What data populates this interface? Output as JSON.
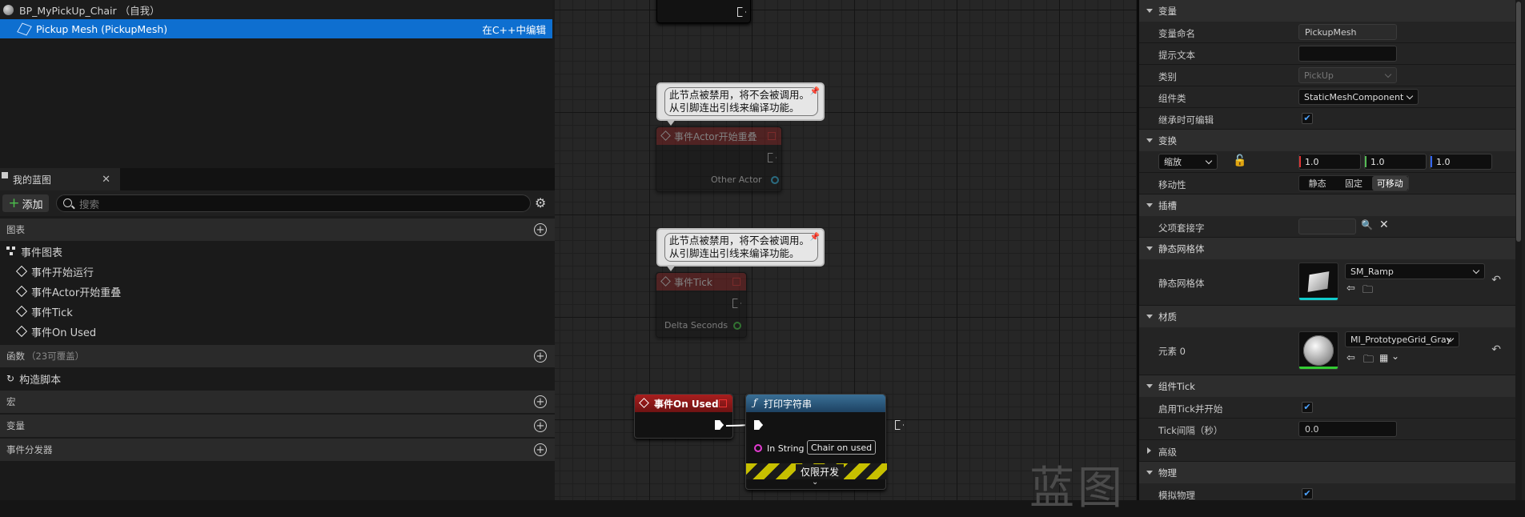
{
  "components": {
    "root_label": "BP_MyPickUp_Chair （自我）",
    "selected_label": "Pickup Mesh (PickupMesh)",
    "selected_action": "在C++中编辑"
  },
  "my_blueprint": {
    "tab_label": "我的蓝图",
    "add_label": "添加",
    "search_placeholder": "搜索",
    "sections": {
      "graphs": "图表",
      "functions": "函数",
      "functions_sub": "（23可覆盖）",
      "macros": "宏",
      "variables": "变量",
      "dispatchers": "事件分发器"
    },
    "graph_items": [
      "事件图表",
      "事件开始运行",
      "事件Actor开始重叠",
      "事件Tick",
      "事件On Used"
    ],
    "function_items": [
      "构造脚本"
    ]
  },
  "graph": {
    "comment_text_1": "此节点被禁用，将不会被调用。",
    "comment_text_2": "从引脚连出引线来编译功能。",
    "node_overlap_title": "事件Actor开始重叠",
    "node_overlap_pin": "Other Actor",
    "node_tick_title": "事件Tick",
    "node_tick_pin": "Delta Seconds",
    "node_onused_title": "事件On Used",
    "node_print_title": "打印字符串",
    "node_print_pin": "In String",
    "node_print_value": "Chair on used",
    "node_print_devonly": "仅限开发",
    "watermark": "蓝图"
  },
  "details": {
    "cat_variable": "变量",
    "var_name_label": "变量命名",
    "var_name_value": "PickupMesh",
    "tooltip_label": "提示文本",
    "tooltip_value": "",
    "category_label": "类别",
    "category_value": "PickUp",
    "comp_class_label": "组件类",
    "comp_class_value": "StaticMeshComponent",
    "editable_label": "继承时可编辑",
    "cat_transform": "变换",
    "scale_label": "缩放",
    "scale_x": "1.0",
    "scale_y": "1.0",
    "scale_z": "1.0",
    "mobility_label": "移动性",
    "mobility_options": [
      "静态",
      "固定",
      "可移动"
    ],
    "mobility_selected": "可移动",
    "cat_socket": "插槽",
    "parent_socket_label": "父项套接字",
    "cat_static_mesh": "静态网格体",
    "static_mesh_label": "静态网格体",
    "static_mesh_value": "SM_Ramp",
    "cat_materials": "材质",
    "element_label": "元素 0",
    "material_value": "MI_PrototypeGrid_Gray",
    "cat_component_tick": "组件Tick",
    "start_tick_label": "启用Tick并开始",
    "tick_interval_label": "Tick间隔（秒）",
    "tick_interval_value": "0.0",
    "advanced_label": "高级",
    "cat_physics": "物理",
    "simulate_physics_label": "模拟物理"
  },
  "colors": {
    "selection_blue": "#0e6fd0",
    "event_red": "#9b1b1b",
    "function_blue": "#2a5d85",
    "check_blue": "#4da3ff"
  }
}
